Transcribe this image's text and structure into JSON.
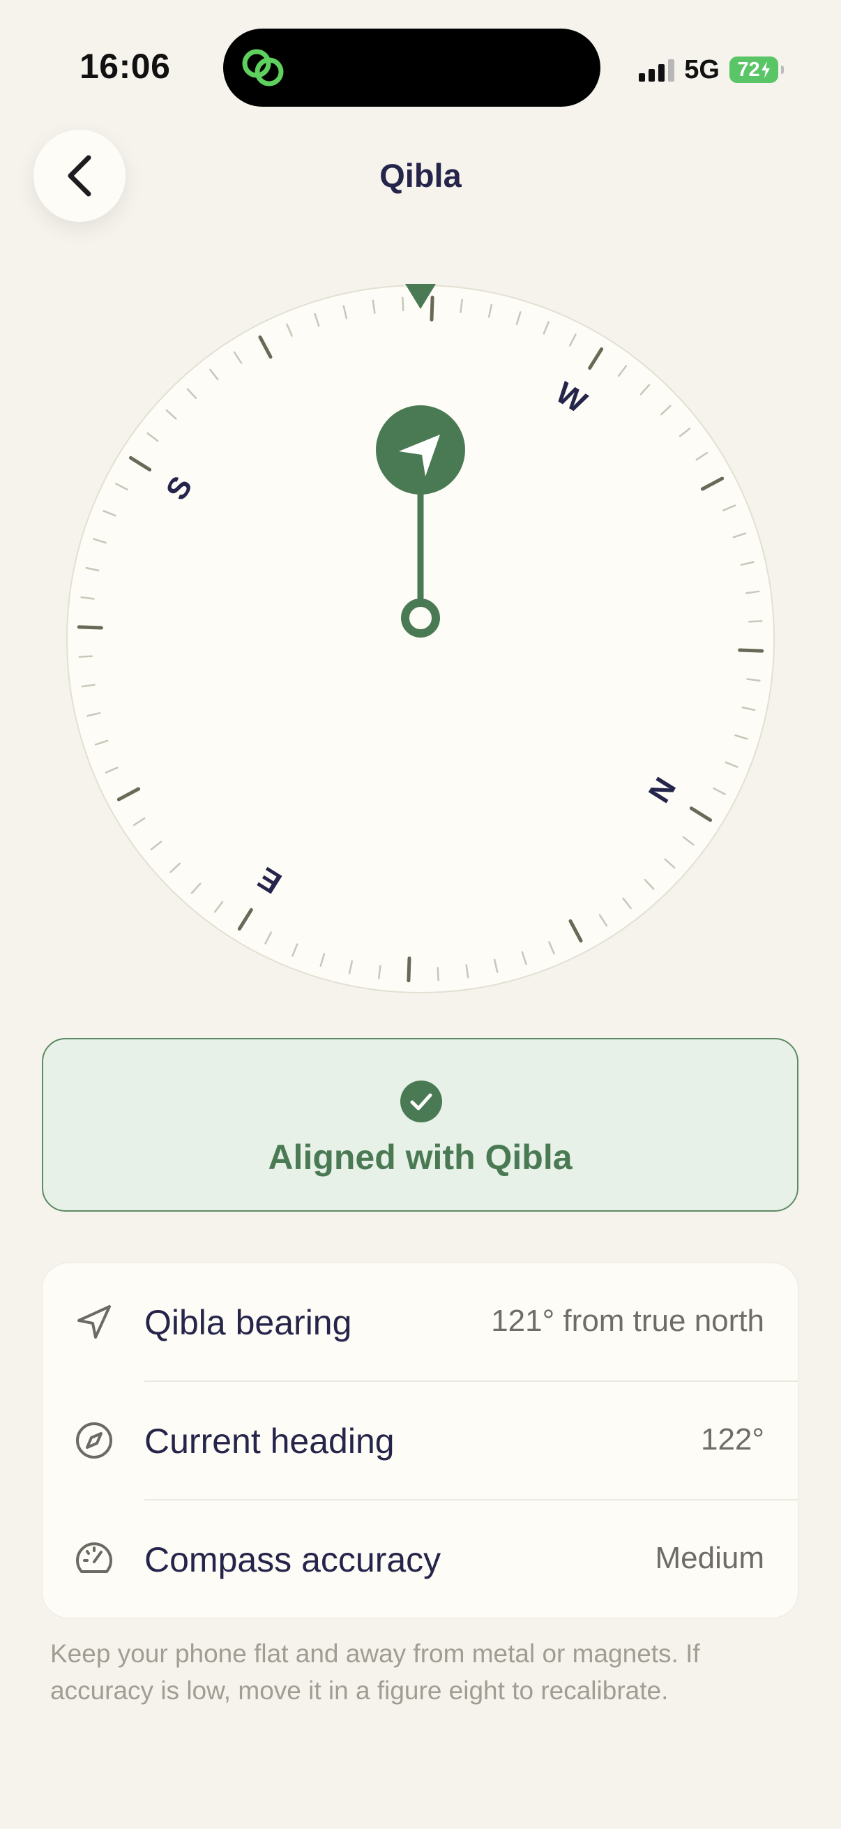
{
  "status_bar": {
    "time": "16:06",
    "network": "5G",
    "battery": "72"
  },
  "header": {
    "title": "Qibla",
    "back_icon": "chevron-left-icon"
  },
  "compass": {
    "cardinal_labels": [
      "N",
      "E",
      "S",
      "W"
    ],
    "rotation_degrees": 122,
    "qibla_bearing": 121,
    "accent_color": "#4a7a54"
  },
  "alignment": {
    "status": "Aligned with Qibla",
    "icon": "check-circle-icon"
  },
  "info": {
    "rows": [
      {
        "icon": "navigation-arrow-icon",
        "label": "Qibla bearing",
        "value": "121° from true north"
      },
      {
        "icon": "compass-icon",
        "label": "Current heading",
        "value": "122°"
      },
      {
        "icon": "speedometer-icon",
        "label": "Compass accuracy",
        "value": "Medium"
      }
    ]
  },
  "footnote": "Keep your phone flat and away from metal or magnets. If accuracy is low, move it in a figure eight to recalibrate."
}
